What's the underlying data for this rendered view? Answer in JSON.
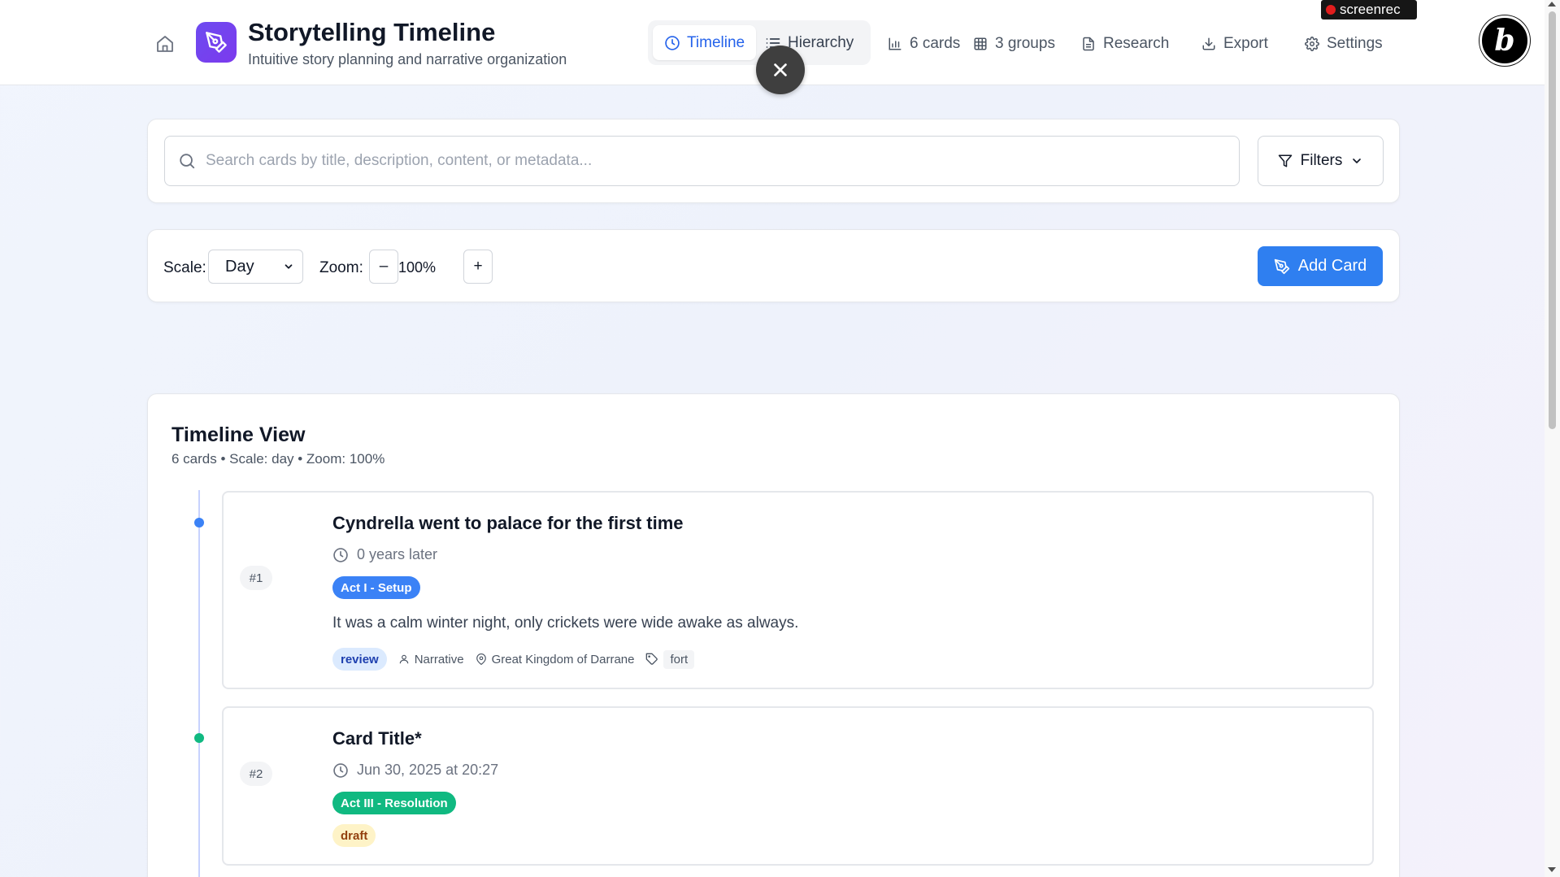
{
  "header": {
    "title": "Storytelling Timeline",
    "subtitle": "Intuitive story planning and narrative organization",
    "tabs": [
      {
        "label": "Timeline",
        "icon": "clock-icon",
        "active": true
      },
      {
        "label": "Hierarchy",
        "icon": "list-icon",
        "active": false
      }
    ],
    "stats": {
      "cards": "6 cards",
      "groups": "3 groups"
    },
    "nav": {
      "research": "Research",
      "export": "Export",
      "settings": "Settings"
    },
    "recorder_label": "screenrec",
    "badge_letter": "b"
  },
  "search": {
    "placeholder": "Search cards by title, description, content, or metadata...",
    "value": "",
    "filters_label": "Filters"
  },
  "controls": {
    "scale_label": "Scale:",
    "scale_value": "Day",
    "zoom_label": "Zoom:",
    "zoom_minus": "–",
    "zoom_value": "100%",
    "zoom_plus": "+",
    "add_card_label": "Add Card"
  },
  "timeline": {
    "title": "Timeline View",
    "meta": "6 cards • Scale: day • Zoom: 100%",
    "cards": [
      {
        "number": "#1",
        "title": "Cyndrella went to palace for the first time",
        "time": "0 years later",
        "act": "Act I - Setup",
        "act_color": "#3b82f6",
        "description": "It was a calm winter night, only crickets were wide awake as always.",
        "status": "review",
        "status_bg": "#dbeafe",
        "status_color": "#1e40af",
        "perspective": "Narrative",
        "location": "Great Kingdom of Darrane",
        "tag": "fort",
        "dot_color": "#3b82f6"
      },
      {
        "number": "#2",
        "title": "Card Title*",
        "time": "Jun 30, 2025 at 20:27",
        "act": "Act III - Resolution",
        "act_color": "#10b981",
        "status": "draft",
        "status_bg": "#fef3c7",
        "status_color": "#92400e",
        "dot_color": "#10b981"
      }
    ]
  },
  "colors": {
    "accent": "#2563eb",
    "logo": "#7c3aed",
    "add_button": "#2f7ff0"
  }
}
